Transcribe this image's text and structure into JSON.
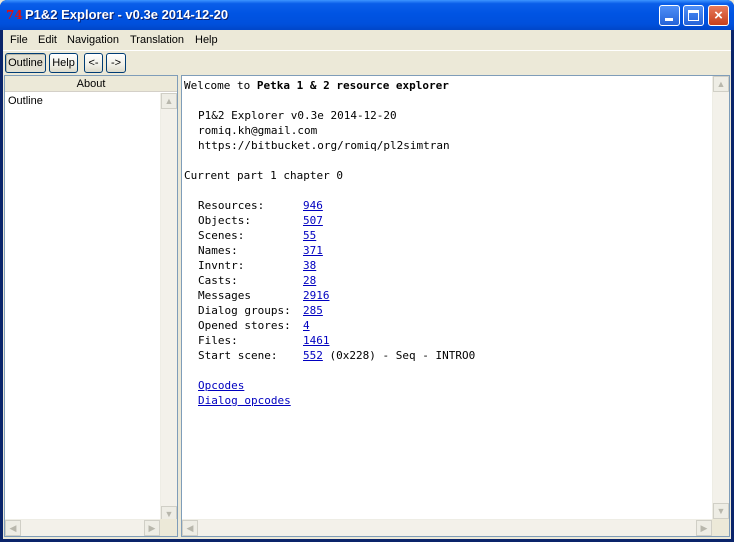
{
  "window": {
    "title": "P1&2 Explorer - v0.3e 2014-12-20",
    "icon_text": "74",
    "controls": {
      "minimize": "minimize",
      "maximize": "maximize",
      "close": "×"
    }
  },
  "menu": [
    "File",
    "Edit",
    "Navigation",
    "Translation",
    "Help"
  ],
  "toolbar": {
    "outline_label": "Outline",
    "help_label": "Help",
    "back_label": "<-",
    "forward_label": "->"
  },
  "left_pane": {
    "header": "About",
    "items": [
      "Outline"
    ]
  },
  "content": {
    "welcome_prefix": "Welcome to ",
    "welcome_bold": "Petka 1 & 2 resource explorer",
    "app_version": "P1&2 Explorer v0.3e 2014-12-20",
    "email": "romiq.kh@gmail.com",
    "url": "https://bitbucket.org/romiq/pl2simtran",
    "current": "Current part 1 chapter 0",
    "stats": [
      {
        "label": "Resources:",
        "value": "946"
      },
      {
        "label": "Objects:",
        "value": "507"
      },
      {
        "label": "Scenes:",
        "value": "55"
      },
      {
        "label": "Names:",
        "value": "371"
      },
      {
        "label": "Invntr:",
        "value": "38"
      },
      {
        "label": "Casts:",
        "value": "28"
      },
      {
        "label": "Messages",
        "value": "2916"
      },
      {
        "label": "Dialog groups:",
        "value": "285"
      },
      {
        "label": "Opened stores:",
        "value": "4"
      },
      {
        "label": "Files:",
        "value": "1461"
      },
      {
        "label": "Start scene:",
        "value": "552",
        "suffix": " (0x228) - Seq - INTRO0"
      }
    ],
    "opcodes_link": "Opcodes",
    "dialog_opcodes_link": "Dialog opcodes"
  },
  "scroll_glyphs": {
    "up": "▲",
    "down": "▼",
    "left": "◀",
    "right": "▶"
  }
}
